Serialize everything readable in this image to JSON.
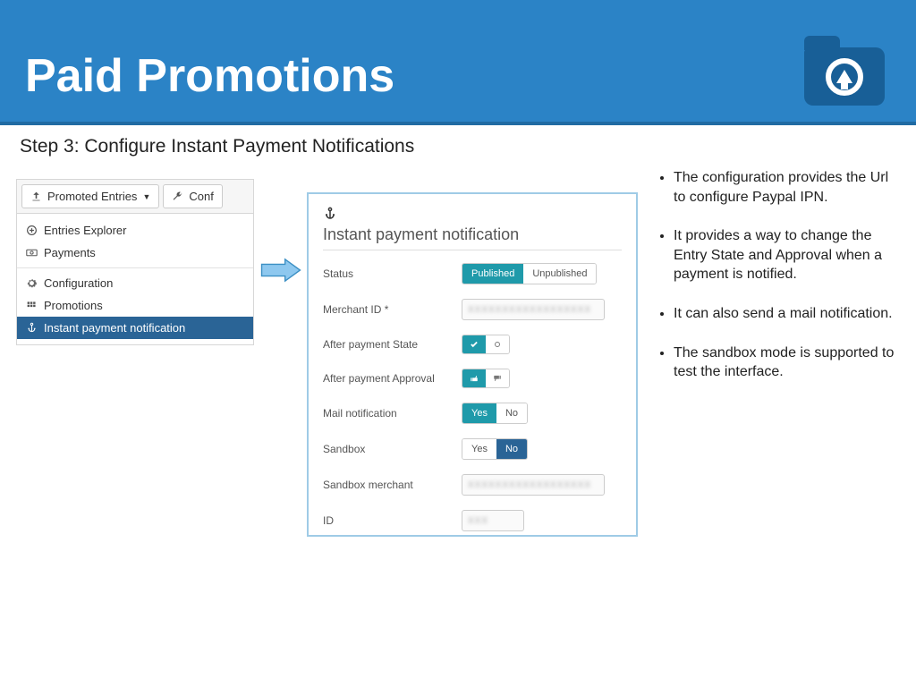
{
  "slide": {
    "title": "Paid Promotions",
    "subtitle": "Step 3: Configure Instant Payment Notifications"
  },
  "sidebar": {
    "toolbar": {
      "promoted": "Promoted Entries",
      "conf": "Conf"
    },
    "items": [
      {
        "icon": "plus-circle",
        "label": "Entries Explorer"
      },
      {
        "icon": "money",
        "label": "Payments"
      },
      {
        "icon": "gear",
        "label": "Configuration"
      },
      {
        "icon": "list",
        "label": "Promotions"
      },
      {
        "icon": "anchor",
        "label": "Instant payment notification",
        "active": true
      }
    ]
  },
  "form": {
    "heading": "Instant payment notification",
    "rows": {
      "status": {
        "label": "Status",
        "opt1": "Published",
        "opt2": "Unpublished",
        "selected": 1
      },
      "merchant": {
        "label": "Merchant ID  *"
      },
      "after_state": {
        "label": "After payment State"
      },
      "after_approval": {
        "label": "After payment Approval"
      },
      "mail": {
        "label": "Mail notification",
        "opt1": "Yes",
        "opt2": "No",
        "selected": 1
      },
      "sandbox": {
        "label": "Sandbox",
        "opt1": "Yes",
        "opt2": "No",
        "selected": 2
      },
      "sandbox_merchant": {
        "label": "Sandbox merchant"
      },
      "id": {
        "label": "ID"
      }
    }
  },
  "bullets": [
    "The configuration provides the Url to configure Paypal IPN.",
    "It provides a way to change the Entry State and Approval when a payment is notified.",
    "It can also send a mail notification.",
    "The sandbox mode is supported to test the interface."
  ]
}
